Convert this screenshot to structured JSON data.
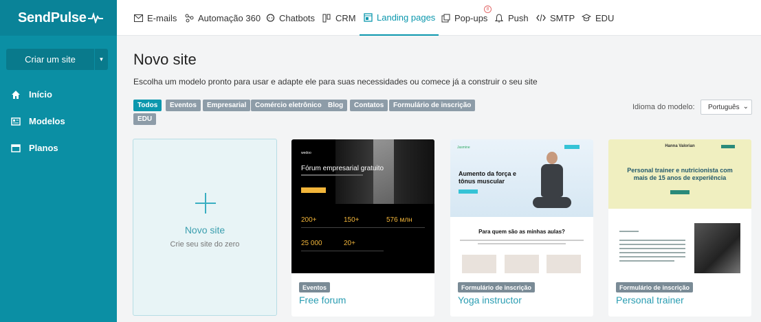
{
  "brand": {
    "name": "SendPulse"
  },
  "sidebar": {
    "create_button": "Criar um site",
    "items": [
      {
        "label": "Início",
        "icon": "home-icon"
      },
      {
        "label": "Modelos",
        "icon": "templates-icon"
      },
      {
        "label": "Planos",
        "icon": "plans-icon"
      }
    ]
  },
  "topnav": {
    "tabs": [
      {
        "label": "E-mails",
        "icon": "mail-icon"
      },
      {
        "label": "Automação 360",
        "icon": "automation-icon"
      },
      {
        "label": "Chatbots",
        "icon": "chat-icon"
      },
      {
        "label": "CRM",
        "icon": "crm-icon"
      },
      {
        "label": "Landing pages",
        "icon": "landing-icon",
        "active": true
      },
      {
        "label": "Pop-ups",
        "icon": "popup-icon",
        "badge": "8"
      },
      {
        "label": "Push",
        "icon": "bell-icon"
      },
      {
        "label": "SMTP",
        "icon": "code-icon"
      },
      {
        "label": "EDU",
        "icon": "graduation-cap-icon"
      }
    ]
  },
  "main": {
    "title": "Novo site",
    "subtitle": "Escolha um modelo pronto para usar e adapte ele para suas necessidades ou comece já a construir o seu site",
    "filters": [
      "Todos",
      "Eventos",
      "Empresarial",
      "Comércio eletrônico",
      "Blog",
      "Contatos",
      "Formulário de inscrição",
      "EDU"
    ],
    "active_filter": "Todos",
    "language_label": "Idioma do modelo:",
    "language_value": "Português",
    "new_site": {
      "title": "Novo site",
      "subtitle": "Crie seu site do zero"
    },
    "templates": [
      {
        "tag": "Eventos",
        "name": "Free forum",
        "thumb": {
          "brand": "wedoo",
          "headline": "Fórum empresarial gratuito",
          "stats": [
            "200+",
            "150+",
            "576 млн",
            "25 000",
            "20+"
          ]
        }
      },
      {
        "tag": "Formulário de inscrição",
        "name": "Yoga instructor",
        "thumb": {
          "brand": "Jasmine",
          "headline": "Aumento da força e tônus muscular",
          "section": "Para quem são as minhas aulas?"
        }
      },
      {
        "tag": "Formulário de inscrição",
        "name": "Personal trainer",
        "thumb": {
          "brand": "Hanna Valorian",
          "headline": "Personal trainer e nutricionista com mais de 15 anos de experiência"
        }
      }
    ]
  },
  "colors": {
    "sidebar": "#0b8fa4",
    "accent": "#0b97ad",
    "chip": "#8d9ca8",
    "cta": "#f2b53a"
  }
}
